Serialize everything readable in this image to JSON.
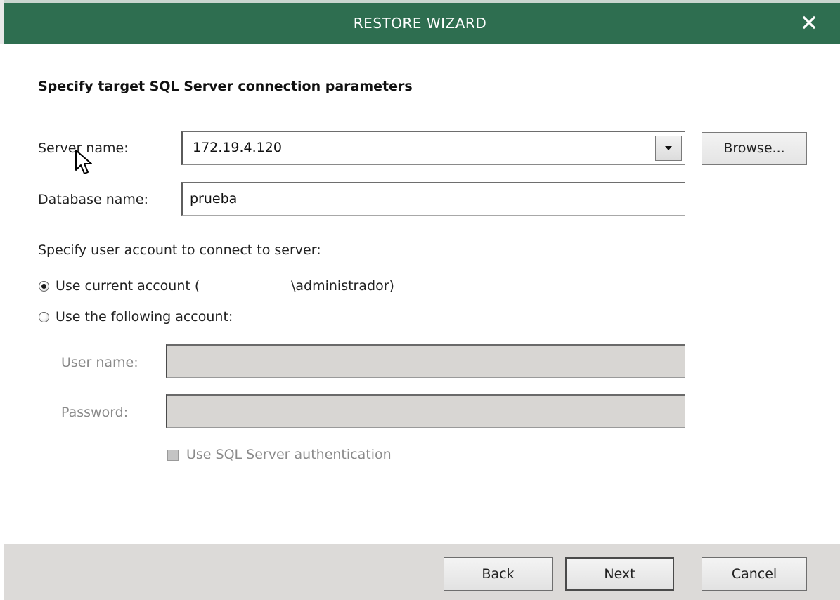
{
  "window": {
    "title": "RESTORE WIZARD",
    "close_icon": "close-icon",
    "accent_color": "#2e6e50"
  },
  "page": {
    "heading": "Specify target SQL Server connection parameters"
  },
  "server": {
    "label": "Server name:",
    "value": "172.19.4.120",
    "browse_label": "Browse..."
  },
  "database": {
    "label": "Database name:",
    "value": "prueba"
  },
  "account": {
    "prompt": "Specify user account to connect to server:",
    "current_account_label": "Use current account (",
    "current_account_suffix": "\\administrador)",
    "current_account_selected": true,
    "following_account_label": "Use the following account:",
    "following_account_selected": false,
    "user_name_label": "User name:",
    "user_name_value": "",
    "password_label": "Password:",
    "password_value": "",
    "sql_auth_label": "Use SQL Server authentication",
    "sql_auth_checked": false
  },
  "footer": {
    "back_label": "Back",
    "next_label": "Next",
    "cancel_label": "Cancel"
  }
}
